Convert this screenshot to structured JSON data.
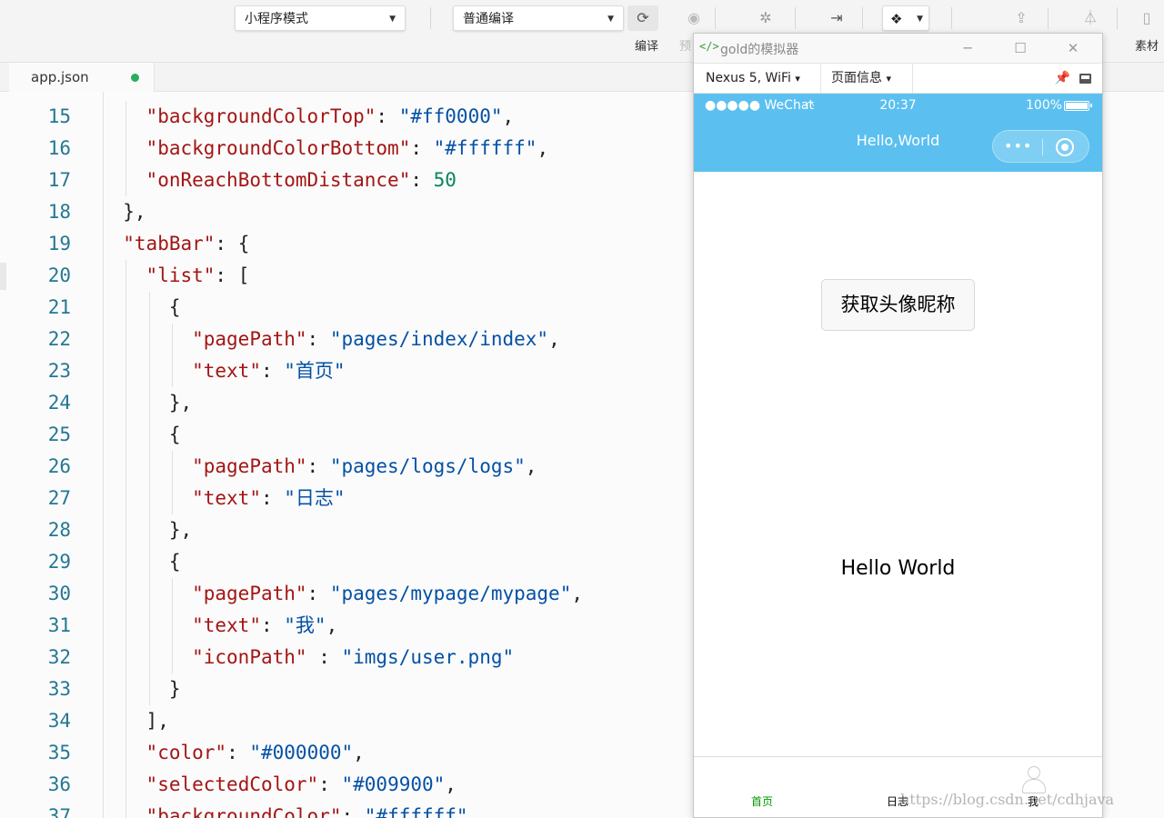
{
  "toolbar": {
    "mode_select": "小程序模式",
    "compile_select": "普通编译",
    "compile_label": "编译",
    "preview_label": "预",
    "assets_label": "素材"
  },
  "editor": {
    "tab_name": "app.json",
    "lines": [
      {
        "num": "15",
        "indent": 2,
        "tokens": [
          {
            "t": "\"backgroundColorTop\"",
            "c": "k"
          },
          {
            "t": ": ",
            "c": "p"
          },
          {
            "t": "\"#ff0000\"",
            "c": "s"
          },
          {
            "t": ",",
            "c": "p"
          }
        ]
      },
      {
        "num": "16",
        "indent": 2,
        "tokens": [
          {
            "t": "\"backgroundColorBottom\"",
            "c": "k"
          },
          {
            "t": ": ",
            "c": "p"
          },
          {
            "t": "\"#ffffff\"",
            "c": "s"
          },
          {
            "t": ",",
            "c": "p"
          }
        ]
      },
      {
        "num": "17",
        "indent": 2,
        "tokens": [
          {
            "t": "\"onReachBottomDistance\"",
            "c": "k"
          },
          {
            "t": ": ",
            "c": "p"
          },
          {
            "t": "50",
            "c": "n"
          }
        ]
      },
      {
        "num": "18",
        "indent": 1,
        "tokens": [
          {
            "t": "},",
            "c": "p"
          }
        ]
      },
      {
        "num": "19",
        "indent": 1,
        "tokens": [
          {
            "t": "\"tabBar\"",
            "c": "k"
          },
          {
            "t": ": {",
            "c": "p"
          }
        ]
      },
      {
        "num": "20",
        "indent": 2,
        "tokens": [
          {
            "t": "\"list\"",
            "c": "k"
          },
          {
            "t": ": [",
            "c": "p"
          }
        ]
      },
      {
        "num": "21",
        "indent": 3,
        "tokens": [
          {
            "t": "{",
            "c": "p"
          }
        ]
      },
      {
        "num": "22",
        "indent": 4,
        "tokens": [
          {
            "t": "\"pagePath\"",
            "c": "k"
          },
          {
            "t": ": ",
            "c": "p"
          },
          {
            "t": "\"pages/index/index\"",
            "c": "s"
          },
          {
            "t": ",",
            "c": "p"
          }
        ]
      },
      {
        "num": "23",
        "indent": 4,
        "tokens": [
          {
            "t": "\"text\"",
            "c": "k"
          },
          {
            "t": ": ",
            "c": "p"
          },
          {
            "t": "\"首页\"",
            "c": "s"
          }
        ]
      },
      {
        "num": "24",
        "indent": 3,
        "tokens": [
          {
            "t": "},",
            "c": "p"
          }
        ]
      },
      {
        "num": "25",
        "indent": 3,
        "tokens": [
          {
            "t": "{",
            "c": "p"
          }
        ]
      },
      {
        "num": "26",
        "indent": 4,
        "tokens": [
          {
            "t": "\"pagePath\"",
            "c": "k"
          },
          {
            "t": ": ",
            "c": "p"
          },
          {
            "t": "\"pages/logs/logs\"",
            "c": "s"
          },
          {
            "t": ",",
            "c": "p"
          }
        ]
      },
      {
        "num": "27",
        "indent": 4,
        "tokens": [
          {
            "t": "\"text\"",
            "c": "k"
          },
          {
            "t": ": ",
            "c": "p"
          },
          {
            "t": "\"日志\"",
            "c": "s"
          }
        ]
      },
      {
        "num": "28",
        "indent": 3,
        "tokens": [
          {
            "t": "},",
            "c": "p"
          }
        ]
      },
      {
        "num": "29",
        "indent": 3,
        "tokens": [
          {
            "t": "{",
            "c": "p"
          }
        ]
      },
      {
        "num": "30",
        "indent": 4,
        "tokens": [
          {
            "t": "\"pagePath\"",
            "c": "k"
          },
          {
            "t": ": ",
            "c": "p"
          },
          {
            "t": "\"pages/mypage/mypage\"",
            "c": "s"
          },
          {
            "t": ",",
            "c": "p"
          }
        ]
      },
      {
        "num": "31",
        "indent": 4,
        "tokens": [
          {
            "t": "\"text\"",
            "c": "k"
          },
          {
            "t": ": ",
            "c": "p"
          },
          {
            "t": "\"我\"",
            "c": "s"
          },
          {
            "t": ",",
            "c": "p"
          }
        ]
      },
      {
        "num": "32",
        "indent": 4,
        "tokens": [
          {
            "t": "\"iconPath\"",
            "c": "k"
          },
          {
            "t": " : ",
            "c": "p"
          },
          {
            "t": "\"imgs/user.png\"",
            "c": "s"
          }
        ]
      },
      {
        "num": "33",
        "indent": 3,
        "tokens": [
          {
            "t": "}",
            "c": "p"
          }
        ]
      },
      {
        "num": "34",
        "indent": 2,
        "tokens": [
          {
            "t": "],",
            "c": "p"
          }
        ]
      },
      {
        "num": "35",
        "indent": 2,
        "tokens": [
          {
            "t": "\"color\"",
            "c": "k"
          },
          {
            "t": ": ",
            "c": "p"
          },
          {
            "t": "\"#000000\"",
            "c": "s"
          },
          {
            "t": ",",
            "c": "p"
          }
        ]
      },
      {
        "num": "36",
        "indent": 2,
        "tokens": [
          {
            "t": "\"selectedColor\"",
            "c": "k"
          },
          {
            "t": ": ",
            "c": "p"
          },
          {
            "t": "\"#009900\"",
            "c": "s"
          },
          {
            "t": ",",
            "c": "p"
          }
        ]
      },
      {
        "num": "37",
        "indent": 2,
        "tokens": [
          {
            "t": "\"backgroundColor\"",
            "c": "k"
          },
          {
            "t": ": ",
            "c": "p"
          },
          {
            "t": "\"#ffffff\"",
            "c": "s"
          },
          {
            "t": ",",
            "c": "p"
          }
        ]
      }
    ]
  },
  "simulator": {
    "window_title": "gold的模拟器",
    "device": "Nexus 5, WiFi",
    "page_info": "页面信息",
    "status": {
      "carrier": "●●●●● WeChat",
      "time": "20:37",
      "battery": "100%"
    },
    "nav_title": "Hello,World",
    "capsule_more": "•••",
    "button_label": "获取头像昵称",
    "hello_text": "Hello World",
    "tabs": [
      {
        "label": "首页",
        "color": "#009900"
      },
      {
        "label": "日志",
        "color": "#000000"
      },
      {
        "label": "我",
        "color": "#000000"
      }
    ]
  },
  "icons": {
    "compile": "refresh-icon",
    "preview": "eye-icon",
    "debug": "bug-icon",
    "remote": "step-icon",
    "layers": "layers-icon",
    "upload": "upload-icon",
    "test": "flask-icon"
  },
  "watermark": "https://blog.csdn.net/cdhjava",
  "colors": {
    "nav_bg": "#5bc0f0",
    "tab_selected": "#009900",
    "tab_normal": "#000000"
  }
}
